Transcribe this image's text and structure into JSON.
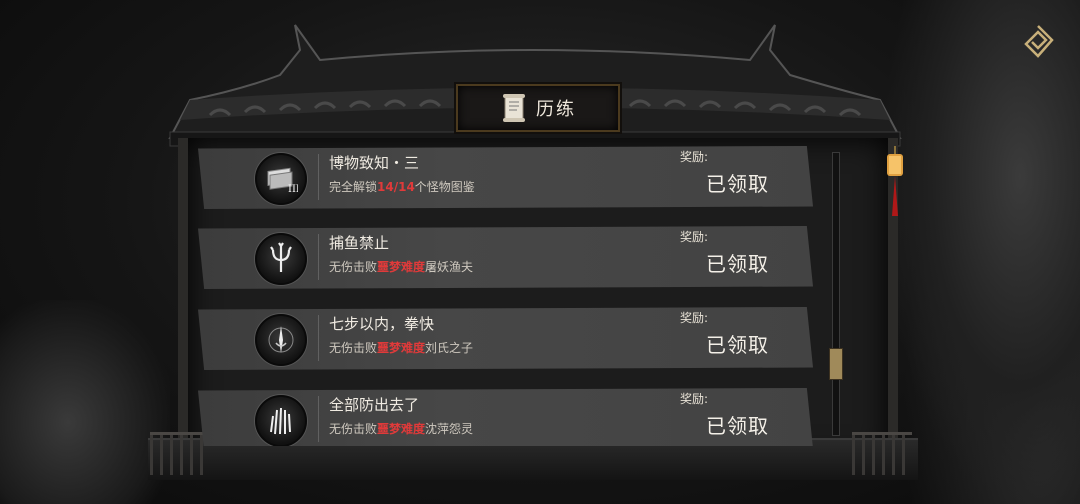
{
  "header": {
    "title": "历练"
  },
  "achievements": [
    {
      "title": "博物致知・三",
      "desc_pre": "完全解锁",
      "desc_hl": "14/14",
      "desc_post": "个怪物图鉴",
      "reward_label": "奖励:",
      "status": "已领取",
      "icon": "book-icon"
    },
    {
      "title": "捕鱼禁止",
      "desc_pre": "无伤击败",
      "desc_hl": "噩梦难度",
      "desc_post": "屠妖渔夫",
      "reward_label": "奖励:",
      "status": "已领取",
      "icon": "trident-icon"
    },
    {
      "title": "七步以内，拳快",
      "desc_pre": "无伤击败",
      "desc_hl": "噩梦难度",
      "desc_post": "刘氏之子",
      "reward_label": "奖励:",
      "status": "已领取",
      "icon": "blade-icon"
    },
    {
      "title": "全部防出去了",
      "desc_pre": "无伤击败",
      "desc_hl": "噩梦难度",
      "desc_post": "沈萍怨灵",
      "reward_label": "奖励:",
      "status": "已领取",
      "icon": "claw-icon"
    }
  ],
  "colors": {
    "highlight": "#e03a3a",
    "accent": "#a08a5a"
  }
}
